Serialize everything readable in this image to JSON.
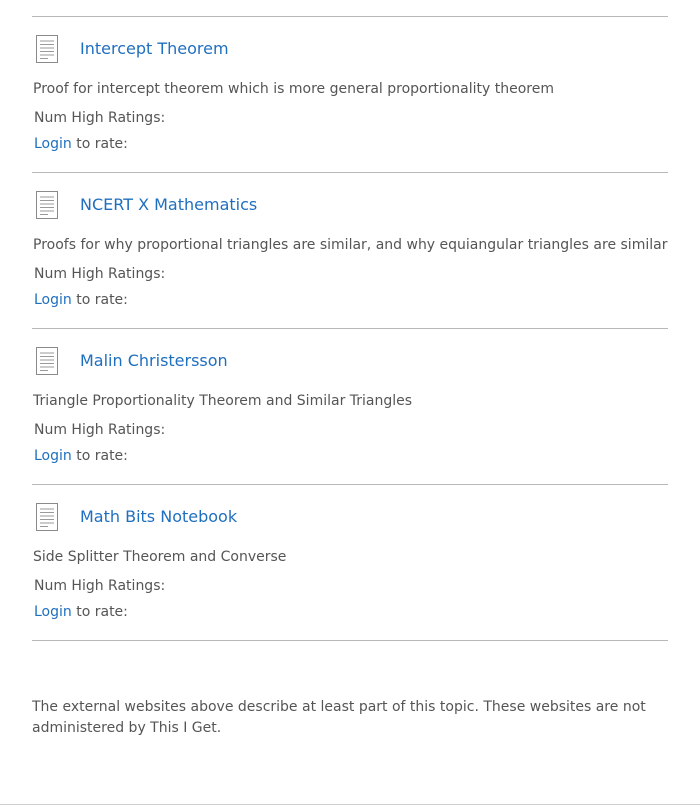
{
  "resources": [
    {
      "icon": "document-icon",
      "title": "Intercept Theorem",
      "description": "Proof for intercept theorem which is more general proportionality theorem",
      "num_high_ratings_label": "Num High Ratings:",
      "login_label": "Login",
      "rate_suffix": " to rate:"
    },
    {
      "icon": "document-icon",
      "title": "NCERT X Mathematics",
      "description": "Proofs for why proportional triangles are similar, and why equiangular triangles are similar",
      "num_high_ratings_label": "Num High Ratings:",
      "login_label": "Login",
      "rate_suffix": " to rate:"
    },
    {
      "icon": "document-icon",
      "title": "Malin Christersson",
      "description": "Triangle Proportionality Theorem and Similar Triangles",
      "num_high_ratings_label": "Num High Ratings:",
      "login_label": "Login",
      "rate_suffix": " to rate:"
    },
    {
      "icon": "document-icon",
      "title": "Math Bits Notebook",
      "description": "Side Splitter Theorem and Converse",
      "num_high_ratings_label": "Num High Ratings:",
      "login_label": "Login",
      "rate_suffix": " to rate:"
    }
  ],
  "footer_note": "The external websites above describe at least part of this topic. These websites are not administered by This I Get.",
  "colors": {
    "link": "#1f6fbf",
    "text": "#555555",
    "divider": "#b8b8b8"
  }
}
